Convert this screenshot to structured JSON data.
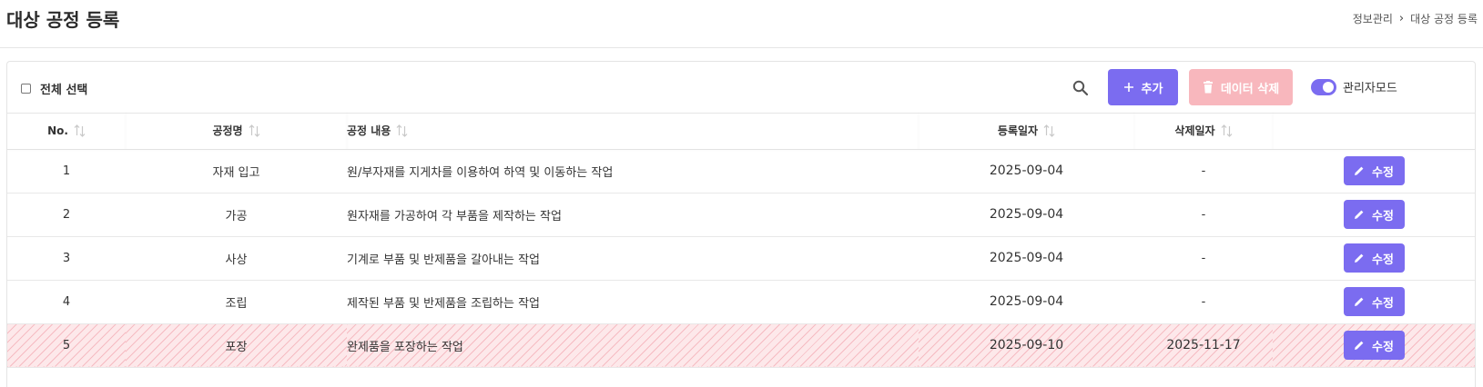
{
  "page": {
    "title": "대상 공정 등록",
    "breadcrumb": [
      "정보관리",
      "대상 공정 등록"
    ],
    "breadcrumb_separator": "›"
  },
  "toolbar": {
    "select_all_label": "전체 선택",
    "search_icon": "search-icon",
    "add_label": "추가",
    "delete_label": "데이터 삭제",
    "admin_mode_label": "관리자모드",
    "admin_mode_on": true
  },
  "colors": {
    "accent": "#7b6cf0",
    "delete_disabled": "#f8b7bd",
    "deleted_row": "#fde8ea"
  },
  "table": {
    "columns": [
      "No.",
      "공정명",
      "공정 내용",
      "등록일자",
      "삭제일자"
    ],
    "edit_label": "수정",
    "rows": [
      {
        "no": "1",
        "name": "자재 입고",
        "desc": "원/부자재를 지게차를 이용하여 하역 및 이동하는 작업",
        "registered": "2025-09-04",
        "deleted": "-",
        "is_deleted": false
      },
      {
        "no": "2",
        "name": "가공",
        "desc": "원자재를 가공하여 각 부품을 제작하는 작업",
        "registered": "2025-09-04",
        "deleted": "-",
        "is_deleted": false
      },
      {
        "no": "3",
        "name": "사상",
        "desc": "기계로 부품 및 반제품을 갈아내는 작업",
        "registered": "2025-09-04",
        "deleted": "-",
        "is_deleted": false
      },
      {
        "no": "4",
        "name": "조립",
        "desc": "제작된 부품 및 반제품을 조립하는 작업",
        "registered": "2025-09-04",
        "deleted": "-",
        "is_deleted": false
      },
      {
        "no": "5",
        "name": "포장",
        "desc": "완제품을 포장하는 작업",
        "registered": "2025-09-10",
        "deleted": "2025-11-17",
        "is_deleted": true
      }
    ]
  }
}
